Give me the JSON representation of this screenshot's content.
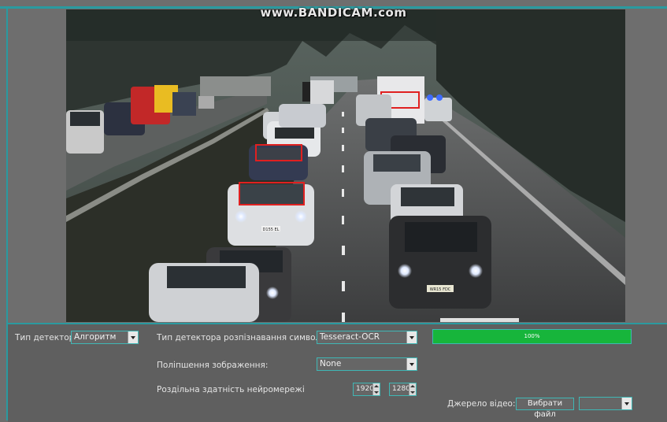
{
  "watermark": "www.BANDICAM.com",
  "video": {
    "plate_front_left": "D155 EL",
    "plate_front_right": "WR15 FDC"
  },
  "controls": {
    "detector_type_label": "Тип детектора:",
    "detector_type_value": "Алгоритм",
    "ocr_detector_label": "Тип детектора розпізнавання символів:",
    "ocr_detector_value": "Tesseract-OCR",
    "enhancement_label": "Поліпшення зображення:",
    "enhancement_value": "None",
    "resolution_label": "Роздільна здатність нейромережі",
    "resolution_width": "1920",
    "resolution_height": "1280",
    "video_source_label": "Джерело відео:",
    "choose_file_label": "Вибрати файл",
    "source_select_value": "",
    "progress_text": "100%",
    "progress_value": 1.0
  },
  "colors": {
    "accent": "#2a9aa0",
    "progress": "#17b53b",
    "detection_box": "#e02020"
  }
}
